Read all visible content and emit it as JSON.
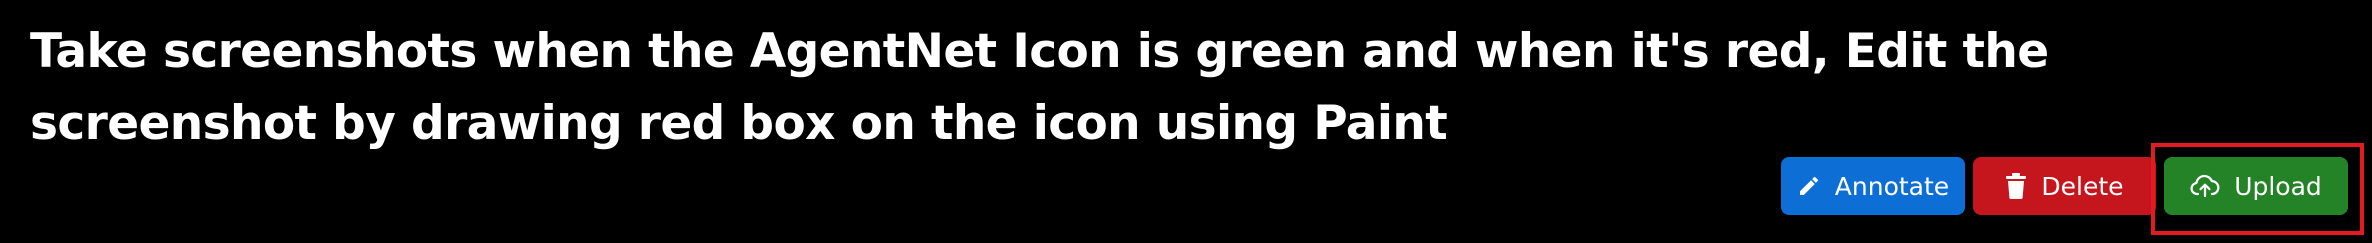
{
  "task": {
    "title": "Take screenshots when the AgentNet Icon is green and when it's red, Edit the screenshot by drawing red box on the icon using Paint"
  },
  "actions": {
    "annotate": {
      "label": "Annotate",
      "icon": "pencil-icon",
      "color": "#0d6fd6"
    },
    "delete": {
      "label": "Delete",
      "icon": "trash-icon",
      "color": "#c5161d"
    },
    "upload": {
      "label": "Upload",
      "icon": "cloud-upload-icon",
      "color": "#238326"
    }
  },
  "highlight": {
    "target": "upload",
    "color": "#e41a22"
  }
}
